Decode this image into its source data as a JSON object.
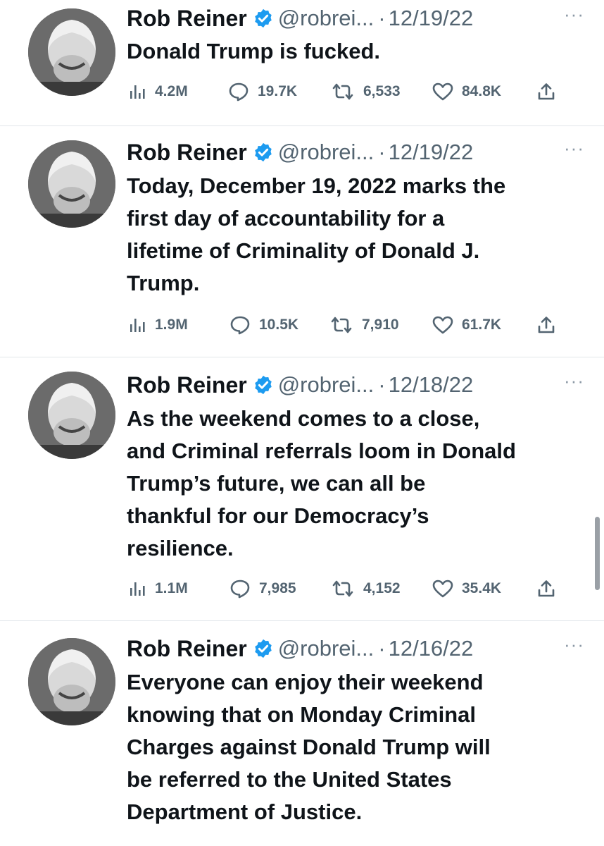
{
  "tweets": [
    {
      "name": "Rob Reiner",
      "handle": "@robrei...",
      "separator": "·",
      "date": "12/19/22",
      "more": "···",
      "lines": [
        "Donald Trump is fucked."
      ],
      "views": "4.2M",
      "replies": "19.7K",
      "retweets": "6,533",
      "likes": "84.8K"
    },
    {
      "name": "Rob Reiner",
      "handle": "@robrei...",
      "separator": "·",
      "date": "12/19/22",
      "more": "···",
      "lines": [
        "Today, December 19, 2022 marks the",
        "first day of accountability for a",
        "lifetime of Criminality of Donald J.",
        "Trump."
      ],
      "views": "1.9M",
      "replies": "10.5K",
      "retweets": "7,910",
      "likes": "61.7K"
    },
    {
      "name": "Rob Reiner",
      "handle": "@robrei...",
      "separator": "·",
      "date": "12/18/22",
      "more": "···",
      "lines": [
        "As the weekend comes to a close,",
        "and Criminal referrals loom in Donald",
        "Trump’s future, we can all be",
        "thankful for our Democracy’s",
        "resilience."
      ],
      "views": "1.1M",
      "replies": "7,985",
      "retweets": "4,152",
      "likes": "35.4K"
    },
    {
      "name": "Rob Reiner",
      "handle": "@robrei...",
      "separator": "·",
      "date": "12/16/22",
      "more": "···",
      "lines": [
        "Everyone can enjoy their weekend",
        "knowing that on Monday Criminal",
        "Charges against Donald Trump will",
        "be referred to the United States",
        "Department of Justice."
      ]
    }
  ],
  "icons": {
    "views": "views-chart-icon",
    "reply": "reply-bubble-icon",
    "retweet": "retweet-arrows-icon",
    "like": "heart-icon",
    "share": "share-upload-icon",
    "verified": "verified-badge-icon"
  },
  "colors": {
    "verified": "#1d9bf0",
    "text": "#0f1419",
    "secondary": "#536471"
  }
}
